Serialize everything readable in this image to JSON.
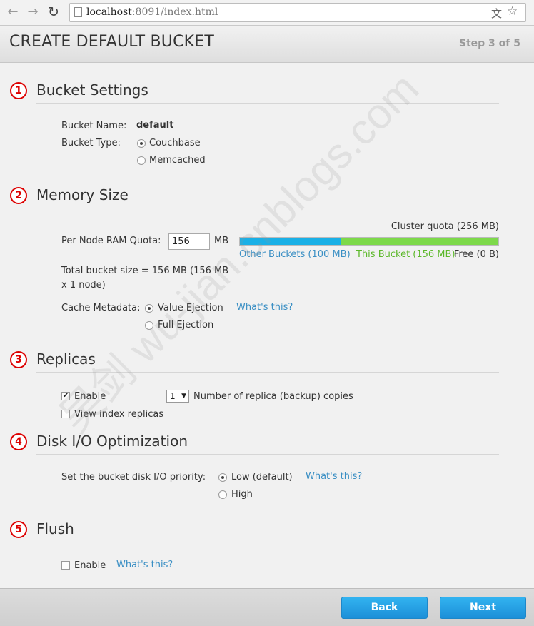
{
  "browser": {
    "url_host": "localhost",
    "url_rest": ":8091/index.html"
  },
  "wizard": {
    "title": "CREATE DEFAULT BUCKET",
    "step": "Step 3 of 5"
  },
  "bucket_settings": {
    "number": "1",
    "title": "Bucket Settings",
    "name_label": "Bucket Name:",
    "name_value": "default",
    "type_label": "Bucket Type:",
    "type_options": [
      "Couchbase",
      "Memcached"
    ],
    "type_selected": "Couchbase"
  },
  "memory_size": {
    "number": "2",
    "title": "Memory Size",
    "quota_label": "Per Node RAM Quota:",
    "quota_value": "156",
    "quota_unit": "MB",
    "cluster_quota": "Cluster quota (256 MB)",
    "other_buckets": "Other Buckets (100 MB)",
    "this_bucket": "This Bucket (156 MB)",
    "free": "Free (0 B)",
    "total_line1": "Total bucket size = 156 MB (156 MB",
    "total_line2": "x 1 node)",
    "cache_label": "Cache Metadata:",
    "cache_options": [
      "Value Ejection",
      "Full Ejection"
    ],
    "cache_selected": "Value Ejection",
    "whats_this": "What's this?",
    "other_color": "#1ab0e6",
    "this_color": "#7dd94a",
    "other_mb": 100,
    "this_mb": 156,
    "total_mb": 256
  },
  "replicas": {
    "number": "3",
    "title": "Replicas",
    "enable_label": "Enable",
    "enable_checked": true,
    "count": "1",
    "count_label": "Number of replica (backup) copies",
    "view_index_label": "View index replicas",
    "view_index_checked": false
  },
  "disk_io": {
    "number": "4",
    "title": "Disk I/O Optimization",
    "priority_label": "Set the bucket disk I/O priority:",
    "options": [
      "Low (default)",
      "High"
    ],
    "selected": "Low (default)",
    "whats_this": "What's this?"
  },
  "flush": {
    "number": "5",
    "title": "Flush",
    "enable_label": "Enable",
    "enable_checked": false,
    "whats_this": "What's this?"
  },
  "footer": {
    "back": "Back",
    "next": "Next"
  },
  "watermark": "吴剑 wu-jian.cnblogs.com"
}
